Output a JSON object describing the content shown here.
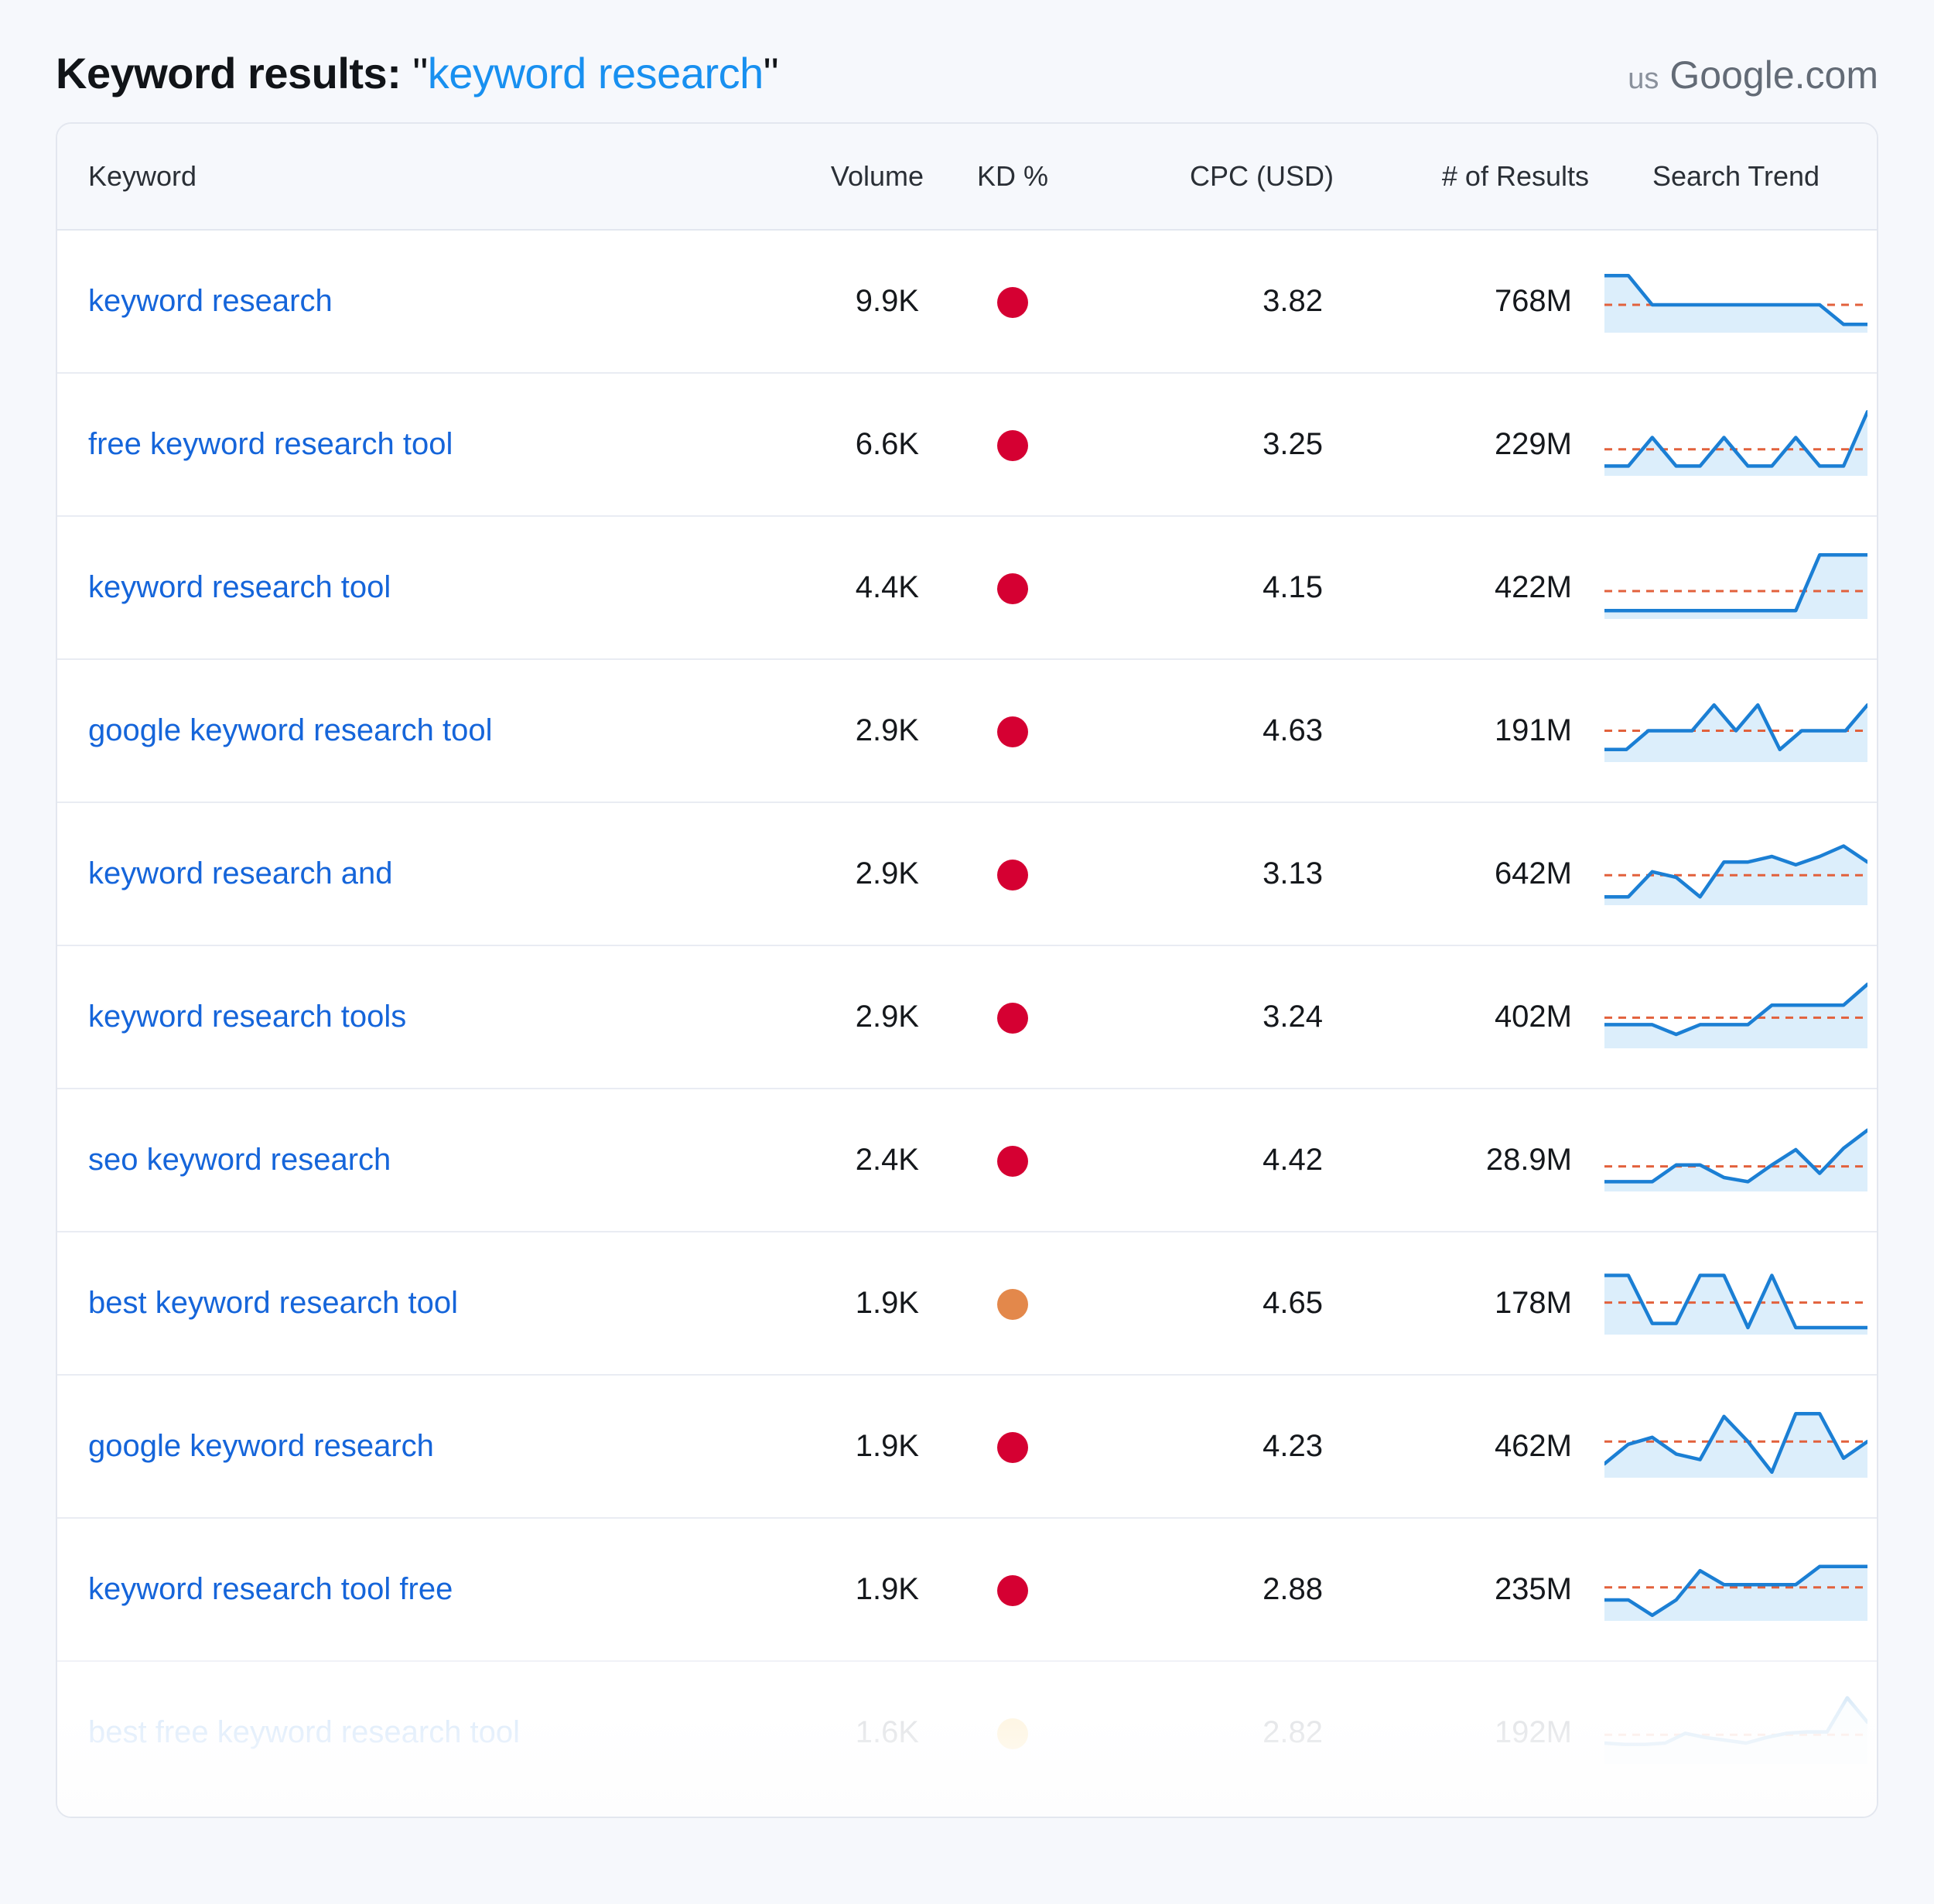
{
  "header": {
    "title_prefix": "Keyword results:",
    "query_open_quote": "\"",
    "query": "keyword research",
    "query_close_quote": "\"",
    "country": "us",
    "engine": "Google.com"
  },
  "table": {
    "columns": [
      {
        "key": "keyword",
        "label": "Keyword"
      },
      {
        "key": "volume",
        "label": "Volume"
      },
      {
        "key": "kd",
        "label": "KD %"
      },
      {
        "key": "cpc",
        "label": "CPC (USD)"
      },
      {
        "key": "results",
        "label": "# of Results"
      },
      {
        "key": "trend",
        "label": "Search Trend"
      }
    ],
    "kd_colors": {
      "very_hard": "#D50032",
      "hard": "#E3884B",
      "medium": "#FBD88A"
    },
    "rows": [
      {
        "keyword": "keyword research",
        "volume": "9.9K",
        "kd_color": "#D50032",
        "kd_level": "very-hard",
        "cpc": "3.82",
        "results": "768M",
        "faded": false
      },
      {
        "keyword": "free keyword research tool",
        "volume": "6.6K",
        "kd_color": "#D50032",
        "kd_level": "very-hard",
        "cpc": "3.25",
        "results": "229M",
        "faded": false
      },
      {
        "keyword": "keyword research tool",
        "volume": "4.4K",
        "kd_color": "#D50032",
        "kd_level": "very-hard",
        "cpc": "4.15",
        "results": "422M",
        "faded": false
      },
      {
        "keyword": "google keyword research tool",
        "volume": "2.9K",
        "kd_color": "#D50032",
        "kd_level": "very-hard",
        "cpc": "4.63",
        "results": "191M",
        "faded": false
      },
      {
        "keyword": "keyword research and",
        "volume": "2.9K",
        "kd_color": "#D50032",
        "kd_level": "very-hard",
        "cpc": "3.13",
        "results": "642M",
        "faded": false
      },
      {
        "keyword": "keyword research tools",
        "volume": "2.9K",
        "kd_color": "#D50032",
        "kd_level": "very-hard",
        "cpc": "3.24",
        "results": "402M",
        "faded": false
      },
      {
        "keyword": "seo keyword research",
        "volume": "2.4K",
        "kd_color": "#D50032",
        "kd_level": "very-hard",
        "cpc": "4.42",
        "results": "28.9M",
        "faded": false
      },
      {
        "keyword": "best keyword research tool",
        "volume": "1.9K",
        "kd_color": "#E3884B",
        "kd_level": "hard",
        "cpc": "4.65",
        "results": "178M",
        "faded": false
      },
      {
        "keyword": "google keyword research",
        "volume": "1.9K",
        "kd_color": "#D50032",
        "kd_level": "very-hard",
        "cpc": "4.23",
        "results": "462M",
        "faded": false
      },
      {
        "keyword": "keyword research tool free",
        "volume": "1.9K",
        "kd_color": "#D50032",
        "kd_level": "very-hard",
        "cpc": "2.88",
        "results": "235M",
        "faded": false
      },
      {
        "keyword": "best free keyword research tool",
        "volume": "1.6K",
        "kd_color": "#FBD88A",
        "kd_level": "medium",
        "cpc": "2.82",
        "results": "192M",
        "faded": true
      }
    ]
  },
  "chart_data": {
    "type": "line",
    "description": "Per-keyword 12-month search trend sparklines with dashed average reference line",
    "line_color": "#1B7FD4",
    "fill_color": "#DCEEFB",
    "average_line_color": "#E2613C",
    "ylim": [
      0,
      100
    ],
    "series": [
      {
        "name": "keyword research",
        "values": [
          82,
          82,
          40,
          40,
          40,
          40,
          40,
          40,
          40,
          40,
          12,
          12
        ],
        "average": 40
      },
      {
        "name": "free keyword research tool",
        "values": [
          14,
          14,
          55,
          14,
          14,
          55,
          14,
          14,
          55,
          14,
          14,
          92
        ],
        "average": 38
      },
      {
        "name": "keyword research tool",
        "values": [
          12,
          12,
          12,
          12,
          12,
          12,
          12,
          12,
          12,
          92,
          92,
          92
        ],
        "average": 40
      },
      {
        "name": "google keyword research tool",
        "values": [
          18,
          18,
          45,
          45,
          45,
          82,
          45,
          82,
          18,
          45,
          45,
          45,
          82
        ],
        "average": 45
      },
      {
        "name": "keyword research and",
        "values": [
          12,
          12,
          48,
          40,
          12,
          62,
          62,
          70,
          58,
          70,
          85,
          62
        ],
        "average": 43
      },
      {
        "name": "keyword research tools",
        "values": [
          34,
          34,
          34,
          20,
          34,
          34,
          34,
          62,
          62,
          62,
          62,
          92
        ],
        "average": 44
      },
      {
        "name": "seo keyword research",
        "values": [
          14,
          14,
          14,
          38,
          38,
          20,
          14,
          38,
          60,
          26,
          62,
          88
        ],
        "average": 36
      },
      {
        "name": "best keyword research tool",
        "values": [
          85,
          85,
          16,
          16,
          85,
          85,
          10,
          85,
          10,
          10,
          10,
          10
        ],
        "average": 46
      },
      {
        "name": "google keyword research",
        "values": [
          20,
          48,
          58,
          34,
          26,
          88,
          52,
          8,
          92,
          92,
          28,
          52
        ],
        "average": 52
      },
      {
        "name": "keyword research tool free",
        "values": [
          30,
          30,
          8,
          30,
          72,
          52,
          52,
          52,
          52,
          78,
          78,
          78
        ],
        "average": 48
      },
      {
        "name": "best free keyword research tool",
        "values": [
          30,
          28,
          28,
          30,
          44,
          38,
          34,
          30,
          38,
          44,
          46,
          46,
          95,
          60
        ],
        "average": 42
      }
    ]
  }
}
